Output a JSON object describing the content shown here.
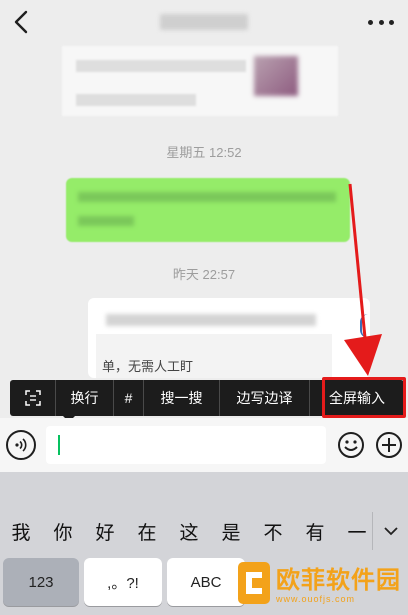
{
  "chat": {
    "timestamps": [
      "星期五 12:52",
      "昨天 22:57"
    ],
    "link_card_text": "单，无需人工盯"
  },
  "context_toolbar": {
    "items": [
      "换行",
      "#",
      "搜一搜",
      "边写边译",
      "全屏输入"
    ],
    "highlighted": "全屏输入",
    "highlight_color": "#e41b1b"
  },
  "input": {
    "value": "",
    "cursor_color": "#07c160"
  },
  "keyboard": {
    "candidates": [
      "我",
      "你",
      "好",
      "在",
      "这",
      "是",
      "不",
      "有",
      "一"
    ],
    "keys": [
      "123",
      ",。?!",
      "ABC"
    ]
  },
  "watermark": {
    "text": "欧菲软件园",
    "url": "www.ouofjs.com"
  },
  "icons": {
    "back": "back-arrow-icon",
    "more": "more-dots-icon",
    "scan": "scan-text-icon",
    "voice": "voice-icon",
    "emoji": "emoji-icon",
    "plus": "plus-icon",
    "chevron": "chevron-down-icon"
  }
}
